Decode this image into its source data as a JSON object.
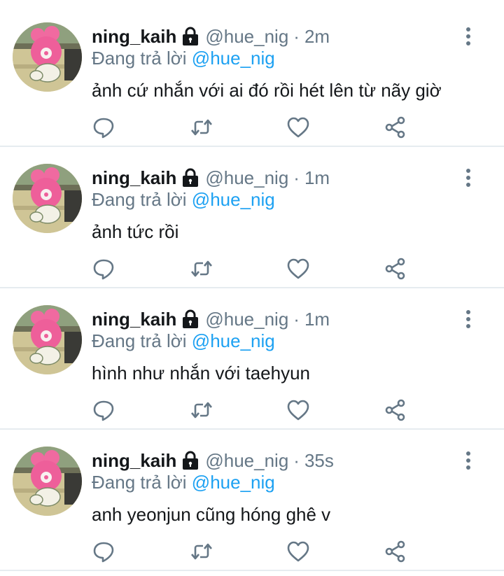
{
  "colors": {
    "accent": "#1da1f2",
    "text": "#14171a",
    "muted": "#657786",
    "divider": "#e6ecf0"
  },
  "tweets": [
    {
      "name": "ning_kaih",
      "handle": "@hue_nig",
      "time": "2m",
      "reply_prefix": "Đang trả lời",
      "reply_to": "@hue_nig",
      "text": "ảnh cứ nhắn với ai đó rồi hét lên từ nãy giờ"
    },
    {
      "name": "ning_kaih",
      "handle": "@hue_nig",
      "time": "1m",
      "reply_prefix": "Đang trả lời",
      "reply_to": "@hue_nig",
      "text": "ảnh tức rồi"
    },
    {
      "name": "ning_kaih",
      "handle": "@hue_nig",
      "time": "1m",
      "reply_prefix": "Đang trả lời",
      "reply_to": "@hue_nig",
      "text": "hình như nhắn với taehyun"
    },
    {
      "name": "ning_kaih",
      "handle": "@hue_nig",
      "time": "35s",
      "reply_prefix": "Đang trả lời",
      "reply_to": "@hue_nig",
      "text": "anh yeonjun cũng hóng ghê v"
    }
  ],
  "icons": {
    "lock": "lock-icon",
    "more": "more-vertical-icon",
    "reply": "reply-icon",
    "retweet": "retweet-icon",
    "like": "heart-icon",
    "share": "share-icon"
  }
}
